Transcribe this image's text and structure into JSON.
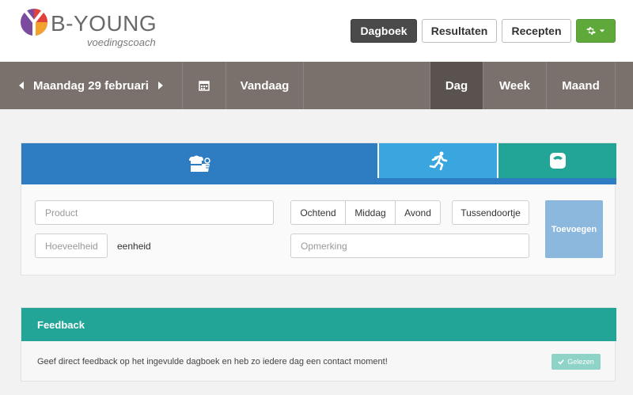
{
  "brand": {
    "name": "B-YOUNG",
    "tagline": "voedingscoach",
    "colors": {
      "purple": "#7b4ba0",
      "red": "#e2403a",
      "orange": "#f2a12d",
      "grey": "#6a6a6a"
    }
  },
  "nav": {
    "diary": "Dagboek",
    "results": "Resultaten",
    "recipes": "Recepten",
    "settings_icon": "gear-icon",
    "active": "Dagboek"
  },
  "datebar": {
    "date": "Maandag 29 februari",
    "today": "Vandaag",
    "views": [
      "Dag",
      "Week",
      "Maand"
    ],
    "active_view": "Dag"
  },
  "entry": {
    "tabs": [
      {
        "icon": "food-icon",
        "color": "#2e7cc2",
        "active": true
      },
      {
        "icon": "running-icon",
        "color": "#3aa6df",
        "active": false
      },
      {
        "icon": "scale-icon",
        "color": "#22a596",
        "active": false
      }
    ],
    "product_placeholder": "Product",
    "amount_placeholder": "Hoeveelheid",
    "unit": "eenheid",
    "meal_times": [
      "Ochtend",
      "Middag",
      "Avond"
    ],
    "snack": "Tussendoortje",
    "note_placeholder": "Opmerking",
    "add_label": "Toevoegen"
  },
  "feedback": {
    "title": "Feedback",
    "text": "Geef direct feedback op het ingevulde dagboek en heb zo iedere dag een contact moment!",
    "read_label": "Gelezen"
  }
}
